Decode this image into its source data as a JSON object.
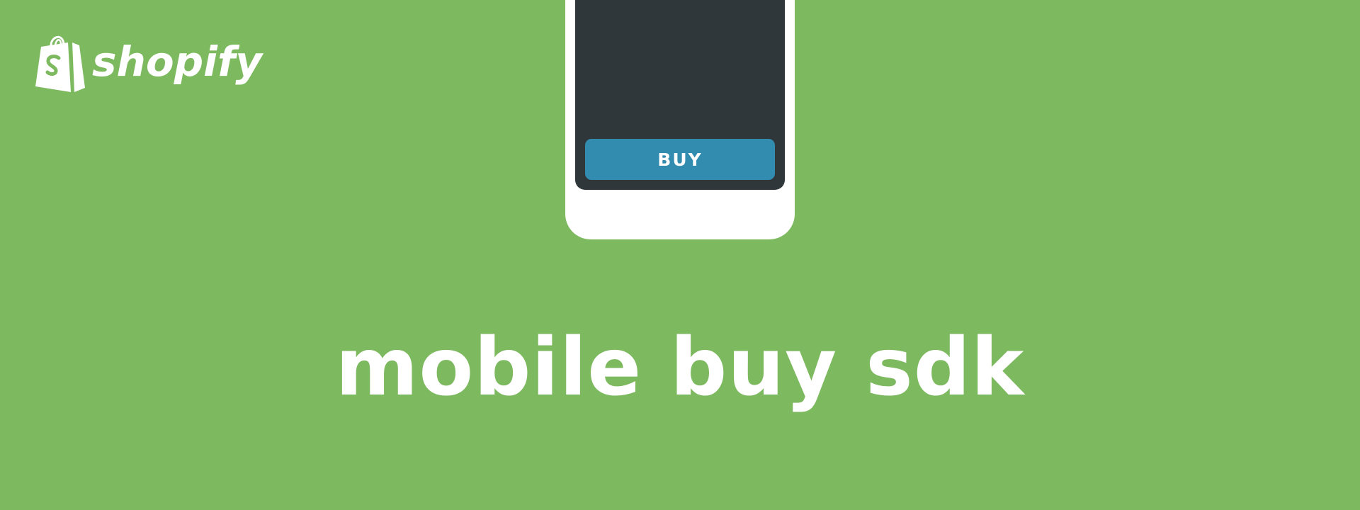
{
  "brand": {
    "name": "shopify",
    "logo_icon": "shopping-bag-icon"
  },
  "phone": {
    "buy_label": "BUY"
  },
  "headline": "mobile buy sdk",
  "colors": {
    "background": "#7db95f",
    "phone_body": "#ffffff",
    "phone_screen": "#2f373b",
    "buy_button": "#318caf",
    "text": "#ffffff"
  }
}
